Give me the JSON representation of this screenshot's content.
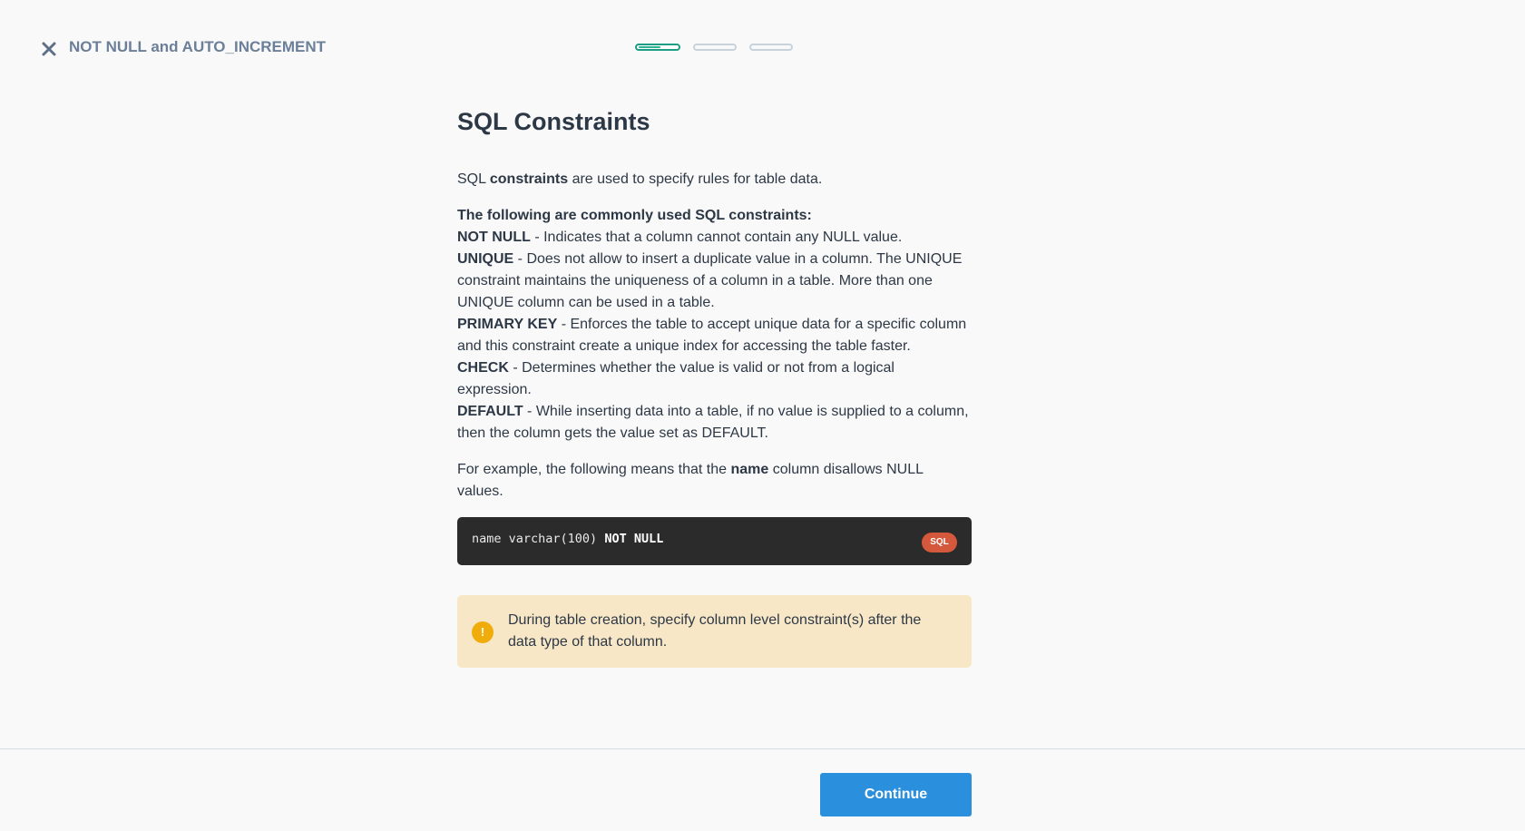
{
  "header": {
    "lesson_title": "NOT NULL and AUTO_INCREMENT",
    "close_icon": "close-icon",
    "progress": {
      "segments": 3,
      "current_segment": 1,
      "current_fill_fraction": 0.55
    }
  },
  "main": {
    "title": "SQL Constraints",
    "intro": {
      "pre": "SQL ",
      "bold": "constraints",
      "post": " are used to specify rules for table data."
    },
    "list_heading": "The following are commonly used SQL constraints:",
    "constraints": [
      {
        "name": "NOT NULL",
        "description": " - Indicates that a column cannot contain any NULL value."
      },
      {
        "name": "UNIQUE",
        "description": " - Does not allow to insert a duplicate value in a column. The UNIQUE constraint maintains the uniqueness of a column in a table. More than one UNIQUE column can be used in a table."
      },
      {
        "name": "PRIMARY KEY",
        "description": " - Enforces the table to accept unique data for a specific column and this constraint create a unique index for accessing the table faster."
      },
      {
        "name": "CHECK",
        "description": " - Determines whether the value is valid or not from a logical expression."
      },
      {
        "name": "DEFAULT",
        "description": " - While inserting data into a table, if no value is supplied to a column, then the column gets the value set as DEFAULT."
      }
    ],
    "example": {
      "pre": "For example, the following means that the ",
      "bold": "name",
      "post": " column disallows NULL values."
    },
    "code": {
      "plain": "name varchar(100) ",
      "keyword": "NOT NULL",
      "language_badge": "SQL"
    },
    "note": {
      "icon": "exclamation-icon",
      "icon_glyph": "!",
      "text": "During table creation, specify column level constraint(s) after the data type of that column."
    }
  },
  "footer": {
    "continue_label": "Continue"
  },
  "colors": {
    "progress_active": "#2ab491",
    "code_background": "#2b2b2b",
    "badge": "#d4583b",
    "note_background": "#f7e7c6",
    "note_icon": "#f0ac0a",
    "button": "#2a8fdc"
  }
}
